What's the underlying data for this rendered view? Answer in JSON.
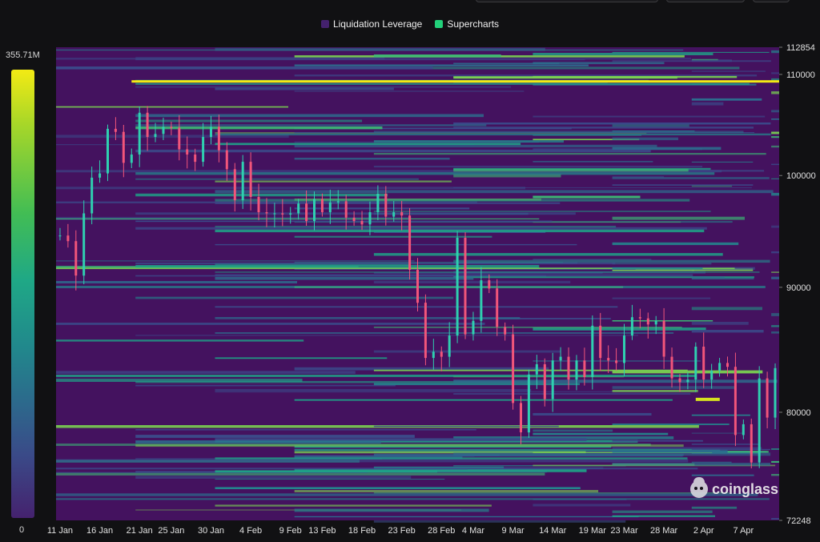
{
  "legend": {
    "items": [
      {
        "label": "Liquidation Leverage",
        "color": "#44216d"
      },
      {
        "label": "Supercharts",
        "color": "#22d07a"
      }
    ]
  },
  "color_scale": {
    "max_label": "355.71M",
    "min_label": "0"
  },
  "watermark": "coinglass",
  "chart_data": {
    "type": "heatmap",
    "title": "",
    "xlabel": "",
    "ylabel": "",
    "x_ticks": [
      "11 Jan",
      "16 Jan",
      "21 Jan",
      "25 Jan",
      "30 Jan",
      "4 Feb",
      "9 Feb",
      "13 Feb",
      "18 Feb",
      "23 Feb",
      "28 Feb",
      "4 Mar",
      "9 Mar",
      "14 Mar",
      "19 Mar",
      "23 Mar",
      "28 Mar",
      "2 Apr",
      "7 Apr"
    ],
    "y_ticks": [
      112854,
      110000,
      100000,
      90000,
      80000,
      72248
    ],
    "ylim": [
      72248,
      112854
    ],
    "y_scale": "log",
    "colorbar_range": [
      0,
      355.71
    ],
    "colorbar_unit": "M",
    "price_series": [
      {
        "x": "11 Jan",
        "y": 94500
      },
      {
        "x": "12 Jan",
        "y": 94000
      },
      {
        "x": "13 Jan",
        "y": 91000
      },
      {
        "x": "14 Jan",
        "y": 96500
      },
      {
        "x": "15 Jan",
        "y": 99800
      },
      {
        "x": "16 Jan",
        "y": 100200
      },
      {
        "x": "17 Jan",
        "y": 104500
      },
      {
        "x": "18 Jan",
        "y": 104200
      },
      {
        "x": "19 Jan",
        "y": 101200
      },
      {
        "x": "20 Jan",
        "y": 102000
      },
      {
        "x": "21 Jan",
        "y": 106100
      },
      {
        "x": "22 Jan",
        "y": 103700
      },
      {
        "x": "23 Jan",
        "y": 104000
      },
      {
        "x": "24 Jan",
        "y": 104700
      },
      {
        "x": "25 Jan",
        "y": 104600
      },
      {
        "x": "26 Jan",
        "y": 102500
      },
      {
        "x": "27 Jan",
        "y": 102000
      },
      {
        "x": "28 Jan",
        "y": 101300
      },
      {
        "x": "29 Jan",
        "y": 103700
      },
      {
        "x": "30 Jan",
        "y": 104700
      },
      {
        "x": "31 Jan",
        "y": 102400
      },
      {
        "x": "1 Feb",
        "y": 100600
      },
      {
        "x": "2 Feb",
        "y": 97700
      },
      {
        "x": "3 Feb",
        "y": 101300
      },
      {
        "x": "4 Feb",
        "y": 98000
      },
      {
        "x": "5 Feb",
        "y": 96600
      },
      {
        "x": "6 Feb",
        "y": 96500
      },
      {
        "x": "7 Feb",
        "y": 96500
      },
      {
        "x": "8 Feb",
        "y": 96400
      },
      {
        "x": "9 Feb",
        "y": 96500
      },
      {
        "x": "10 Feb",
        "y": 97400
      },
      {
        "x": "11 Feb",
        "y": 95800
      },
      {
        "x": "12 Feb",
        "y": 97800
      },
      {
        "x": "13 Feb",
        "y": 96600
      },
      {
        "x": "14 Feb",
        "y": 97500
      },
      {
        "x": "15 Feb",
        "y": 97600
      },
      {
        "x": "16 Feb",
        "y": 96100
      },
      {
        "x": "17 Feb",
        "y": 95800
      },
      {
        "x": "18 Feb",
        "y": 95500
      },
      {
        "x": "19 Feb",
        "y": 96600
      },
      {
        "x": "20 Feb",
        "y": 98300
      },
      {
        "x": "21 Feb",
        "y": 96200
      },
      {
        "x": "22 Feb",
        "y": 96600
      },
      {
        "x": "23 Feb",
        "y": 96300
      },
      {
        "x": "24 Feb",
        "y": 91500
      },
      {
        "x": "25 Feb",
        "y": 88700
      },
      {
        "x": "26 Feb",
        "y": 84200
      },
      {
        "x": "27 Feb",
        "y": 84700
      },
      {
        "x": "28 Feb",
        "y": 84300
      },
      {
        "x": "1 Mar",
        "y": 86000
      },
      {
        "x": "2 Mar",
        "y": 94300
      },
      {
        "x": "3 Mar",
        "y": 86100
      },
      {
        "x": "4 Mar",
        "y": 87200
      },
      {
        "x": "5 Mar",
        "y": 90600
      },
      {
        "x": "6 Mar",
        "y": 89900
      },
      {
        "x": "7 Mar",
        "y": 86700
      },
      {
        "x": "8 Mar",
        "y": 86100
      },
      {
        "x": "9 Mar",
        "y": 80700
      },
      {
        "x": "10 Mar",
        "y": 78500
      },
      {
        "x": "11 Mar",
        "y": 82900
      },
      {
        "x": "12 Mar",
        "y": 83700
      },
      {
        "x": "13 Mar",
        "y": 81000
      },
      {
        "x": "14 Mar",
        "y": 84000
      },
      {
        "x": "15 Mar",
        "y": 84300
      },
      {
        "x": "16 Mar",
        "y": 82500
      },
      {
        "x": "17 Mar",
        "y": 84000
      },
      {
        "x": "18 Mar",
        "y": 82700
      },
      {
        "x": "19 Mar",
        "y": 86800
      },
      {
        "x": "20 Mar",
        "y": 84200
      },
      {
        "x": "21 Mar",
        "y": 84000
      },
      {
        "x": "22 Mar",
        "y": 83800
      },
      {
        "x": "23 Mar",
        "y": 86000
      },
      {
        "x": "24 Mar",
        "y": 87500
      },
      {
        "x": "25 Mar",
        "y": 87400
      },
      {
        "x": "26 Mar",
        "y": 86900
      },
      {
        "x": "27 Mar",
        "y": 87200
      },
      {
        "x": "28 Mar",
        "y": 84300
      },
      {
        "x": "29 Mar",
        "y": 82600
      },
      {
        "x": "30 Mar",
        "y": 82300
      },
      {
        "x": "31 Mar",
        "y": 82500
      },
      {
        "x": "1 Apr",
        "y": 85100
      },
      {
        "x": "2 Apr",
        "y": 82500
      },
      {
        "x": "3 Apr",
        "y": 83200
      },
      {
        "x": "4 Apr",
        "y": 83800
      },
      {
        "x": "5 Apr",
        "y": 83500
      },
      {
        "x": "6 Apr",
        "y": 78300
      },
      {
        "x": "7 Apr",
        "y": 79100
      },
      {
        "x": "8 Apr",
        "y": 76300
      },
      {
        "x": "9 Apr",
        "y": 82600
      },
      {
        "x": "10 Apr",
        "y": 79600
      },
      {
        "x": "11 Apr",
        "y": 83400
      }
    ]
  }
}
